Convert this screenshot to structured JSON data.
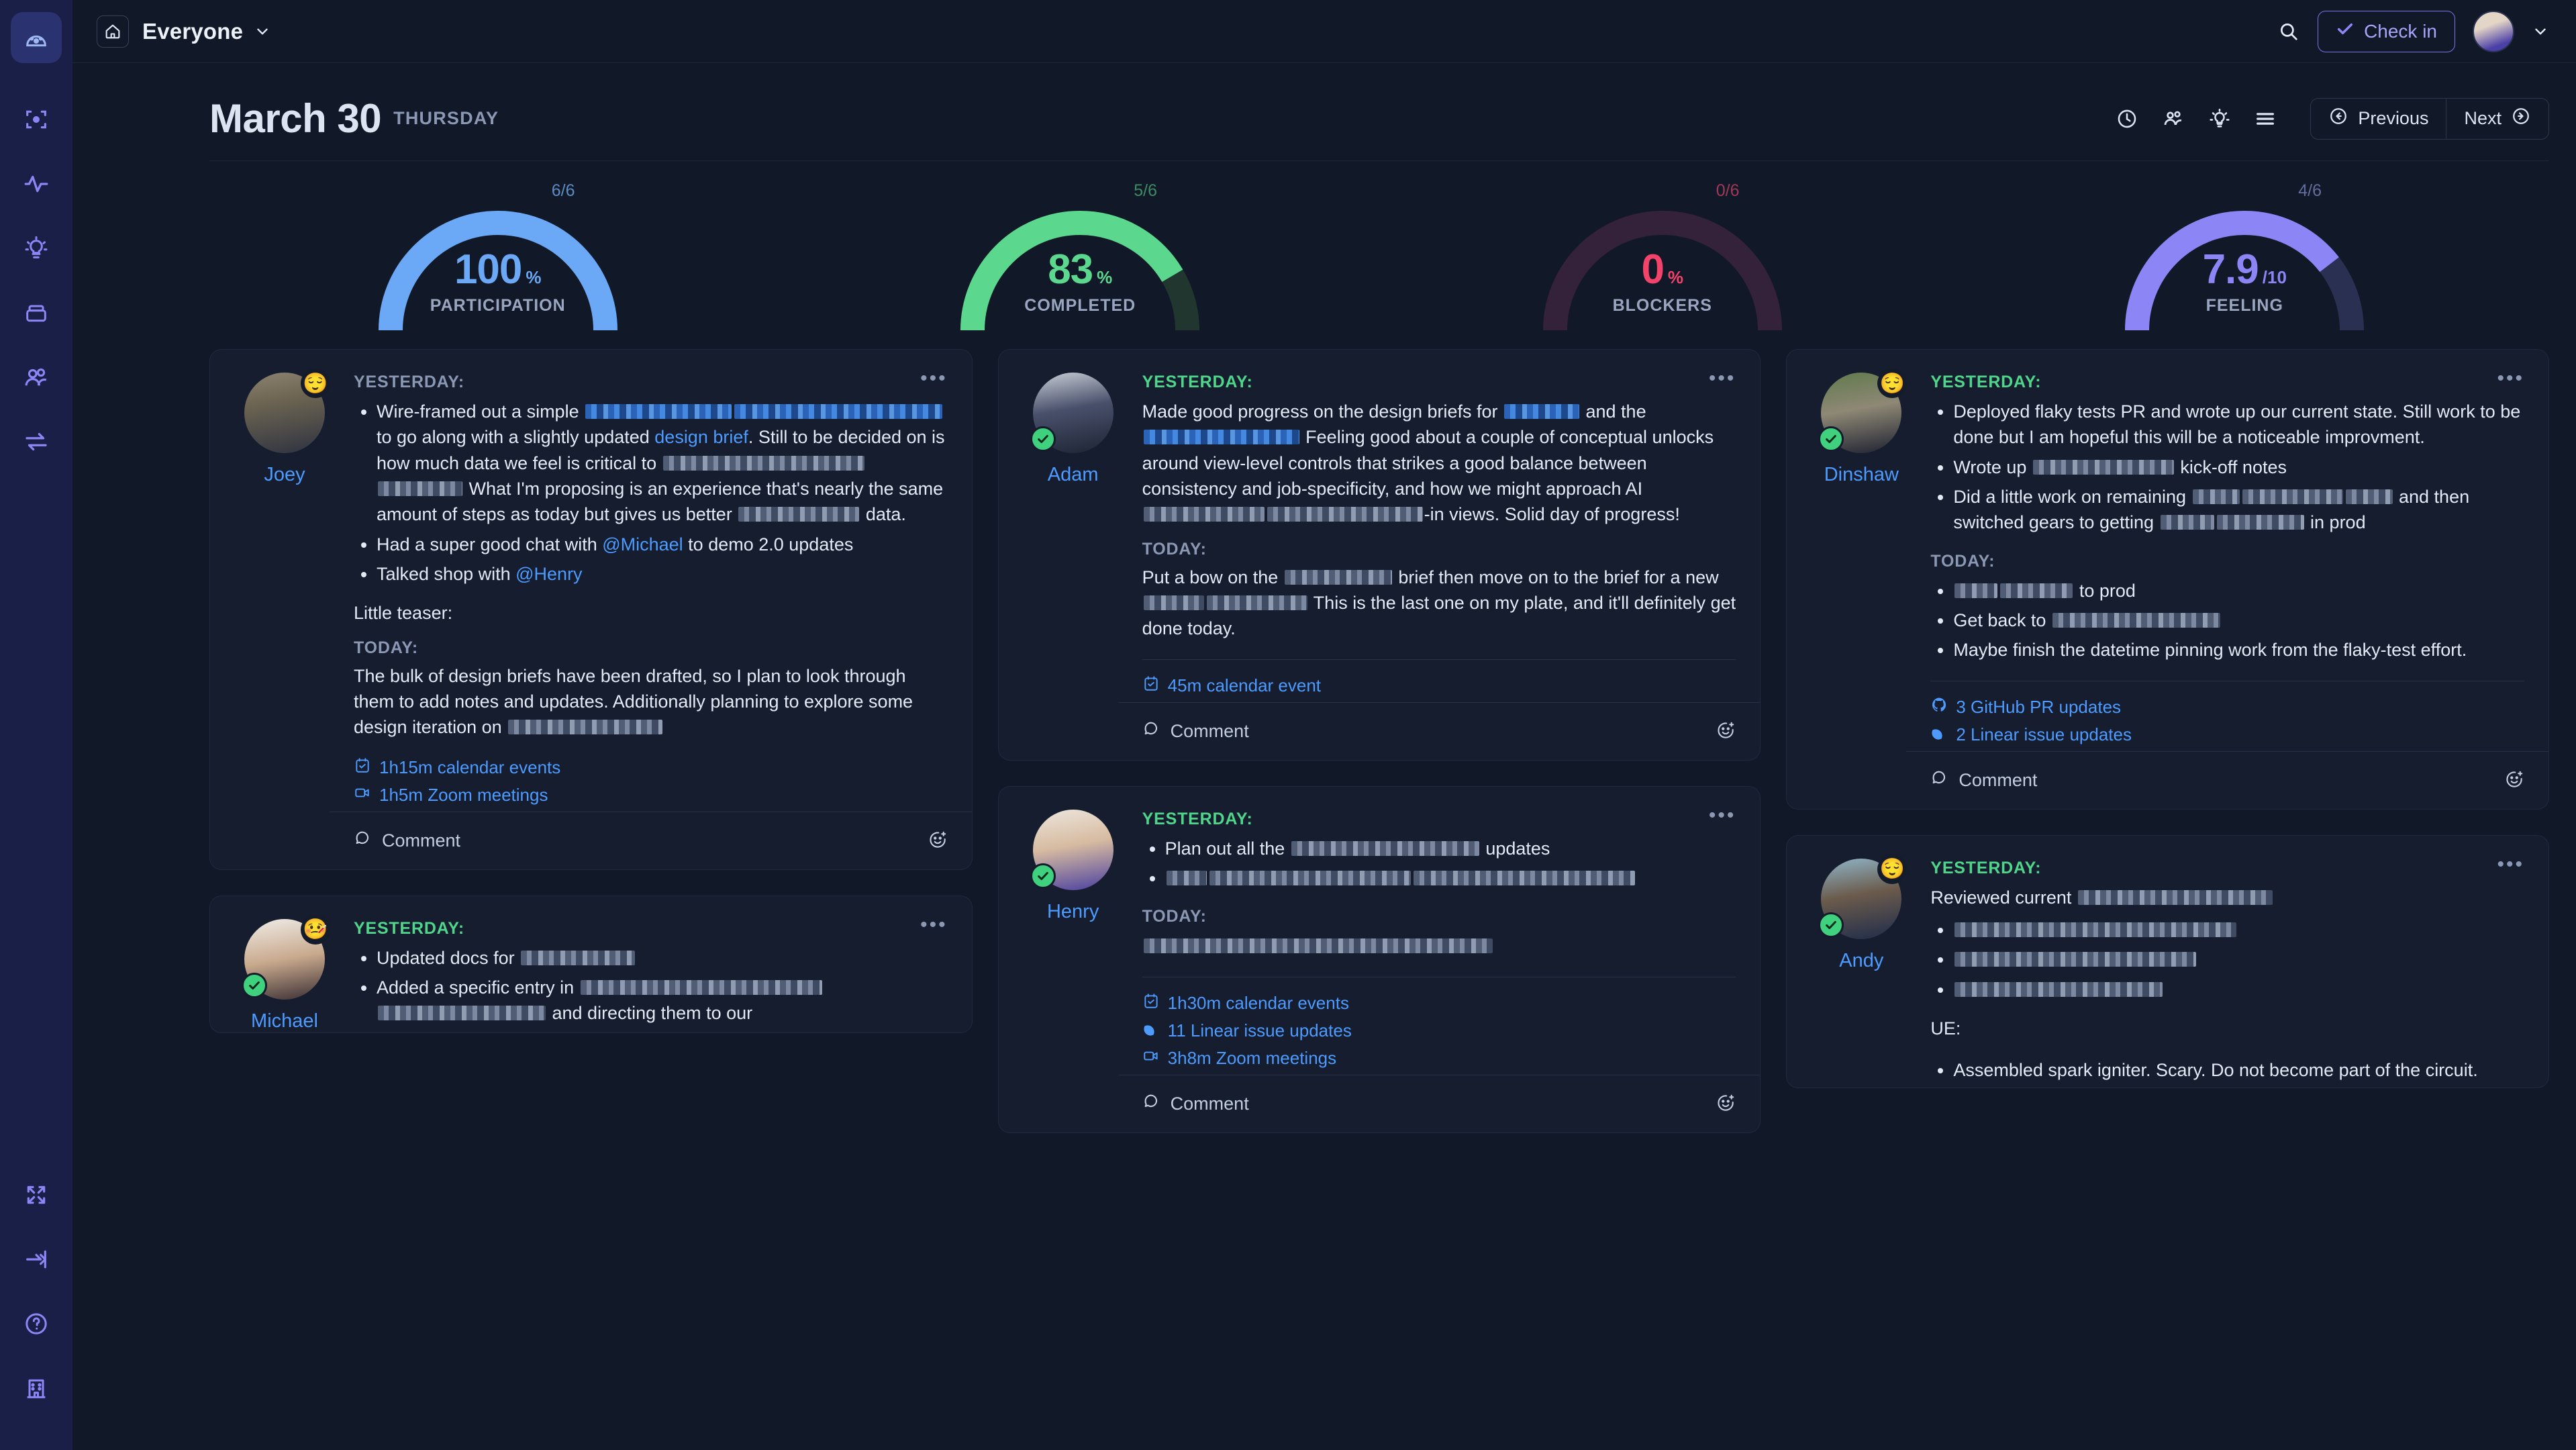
{
  "sidebar": {
    "logo": "dashboard-gauge-logo",
    "items": [
      {
        "icon": "focus-target-icon",
        "name": "focus"
      },
      {
        "icon": "activity-pulse-icon",
        "name": "activity"
      },
      {
        "icon": "lightbulb-icon",
        "name": "ideas"
      },
      {
        "icon": "archive-box-icon",
        "name": "archive"
      },
      {
        "icon": "people-icon",
        "name": "people"
      },
      {
        "icon": "swap-arrows-icon",
        "name": "integrations"
      }
    ],
    "bottom_items": [
      {
        "icon": "expand-icon",
        "name": "expand"
      },
      {
        "icon": "collapse-sidebar-icon",
        "name": "collapse"
      },
      {
        "icon": "help-circle-icon",
        "name": "help"
      },
      {
        "icon": "building-icon",
        "name": "organization"
      }
    ]
  },
  "topbar": {
    "home_icon": "home-icon",
    "space_name": "Everyone",
    "chevron": "chevron-down-icon",
    "search_icon": "search-icon",
    "checkin_label": "Check in",
    "checkin_icon": "check-icon",
    "avatar": "user-avatar",
    "avatar_chevron": "chevron-down-icon"
  },
  "header": {
    "date": "March 30",
    "weekday": "THURSDAY",
    "tools": [
      {
        "icon": "clock-icon",
        "name": "history"
      },
      {
        "icon": "people-icon",
        "name": "participants"
      },
      {
        "icon": "lightbulb-icon",
        "name": "insights"
      },
      {
        "icon": "list-icon",
        "name": "list-view"
      }
    ],
    "previous_label": "Previous",
    "next_label": "Next"
  },
  "gauges": [
    {
      "fraction": "6/6",
      "value": "100",
      "unit": "%",
      "label": "PARTICIPATION",
      "percent": 100,
      "color": "#6BA8F5",
      "track": "#1E2C45"
    },
    {
      "fraction": "5/6",
      "value": "83",
      "unit": "%",
      "label": "COMPLETED",
      "percent": 83,
      "color": "#5CD88E",
      "track": "#20362F"
    },
    {
      "fraction": "0/6",
      "value": "0",
      "unit": "%",
      "label": "BLOCKERS",
      "percent": 0,
      "color": "#F4436B",
      "track": "#33223A"
    },
    {
      "fraction": "4/6",
      "value": "7.9",
      "unit": "/10",
      "label": "FEELING",
      "percent": 79,
      "color": "#8B85F5",
      "track": "#2A3052"
    }
  ],
  "cards": {
    "joey": {
      "author": "Joey",
      "avatar_class": "joey",
      "emoji": "😌",
      "has_check": false,
      "yesterday_label": "YESTERDAY:",
      "today_label": "TODAY:",
      "label_color": "gray",
      "y_b1_a": "Wire-framed out a simple ",
      "y_b1_b": " to go along with a slightly updated ",
      "y_b1_link": "design brief",
      "y_b1_c": ". Still to be decided on is how much data we feel is critical to ",
      "y_b1_d": " What I'm proposing is an experience that's nearly the same amount of steps as today but gives us better ",
      "y_b1_e": " data.",
      "y_b2_a": "Had a super good chat with ",
      "y_b2_mention": "@Michael",
      "y_b2_b": " to demo 2.0 updates",
      "y_b3_a": "Talked shop with ",
      "y_b3_mention": "@Henry",
      "teaser": "Little teaser:",
      "today_text_a": "The bulk of design briefs have been drafted, so I plan to look through them to add notes and updates. Additionally planning to explore some design iteration on ",
      "meta": [
        {
          "icon": "calendar-icon",
          "label": "1h15m calendar events"
        },
        {
          "icon": "video-camera-icon",
          "label": "1h5m Zoom meetings"
        }
      ],
      "comment_label": "Comment"
    },
    "michael": {
      "author": "Michael",
      "avatar_class": "michael",
      "emoji": "🤒",
      "has_check": true,
      "yesterday_label": "YESTERDAY:",
      "label_color": "green",
      "y_b1_a": "Updated docs for ",
      "y_b2_a": "Added a specific entry in ",
      "y_b2_b": " and directing them to our"
    },
    "adam": {
      "author": "Adam",
      "avatar_class": "adam",
      "emoji": null,
      "has_check": true,
      "yesterday_label": "YESTERDAY:",
      "today_label": "TODAY:",
      "label_color": "green",
      "y_text_a": "Made good progress on the design briefs for ",
      "y_text_b": " and the ",
      "y_text_c": " Feeling good about a couple of conceptual unlocks around view-level controls that strikes a good balance between consistency and job-specificity, and how we might approach AI ",
      "y_text_d": "-in views. Solid day of progress!",
      "t_text_a": "Put a bow on the ",
      "t_text_b": " brief then move on to the brief for a new ",
      "t_text_c": " This is the last one on my plate, and it'll definitely get done today.",
      "meta": [
        {
          "icon": "calendar-icon",
          "label": "45m calendar event"
        }
      ],
      "comment_label": "Comment"
    },
    "henry": {
      "author": "Henry",
      "avatar_class": "henry",
      "emoji": null,
      "has_check": true,
      "yesterday_label": "YESTERDAY:",
      "today_label": "TODAY:",
      "label_color": "green",
      "y_b1_a": "Plan out all the ",
      "y_b1_b": " updates",
      "meta": [
        {
          "icon": "calendar-icon",
          "label": "1h30m calendar events"
        },
        {
          "icon": "linear-icon",
          "label": "11 Linear issue updates"
        },
        {
          "icon": "video-camera-icon",
          "label": "3h8m Zoom meetings"
        }
      ],
      "comment_label": "Comment"
    },
    "dinshaw": {
      "author": "Dinshaw",
      "avatar_class": "dinshaw",
      "emoji": "😌",
      "has_check": true,
      "yesterday_label": "YESTERDAY:",
      "today_label": "TODAY:",
      "label_color": "green",
      "y_b1": "Deployed flaky tests PR and wrote up our current state. Still work to be done but I am hopeful this will be a noticeable improvment.",
      "y_b2_a": "Wrote up ",
      "y_b2_b": " kick-off notes",
      "y_b3_a": "Did a little work on remaining ",
      "y_b3_b": " and then switched gears to getting ",
      "y_b3_c": " in prod",
      "t_b1_b": " to prod",
      "t_b2_a": "Get back to ",
      "t_b3": "Maybe finish the datetime pinning work from the flaky-test effort.",
      "meta": [
        {
          "icon": "github-icon",
          "label": "3 GitHub PR updates"
        },
        {
          "icon": "linear-icon",
          "label": "2 Linear issue updates"
        }
      ],
      "comment_label": "Comment"
    },
    "andy": {
      "author": "Andy",
      "avatar_class": "andy",
      "emoji": "😌",
      "has_check": true,
      "yesterday_label": "YESTERDAY:",
      "label_color": "green",
      "y_text_a": "Reviewed current ",
      "ue_label": "UE:",
      "ue_b1": "Assembled spark igniter. Scary. Do not become part of the circuit."
    }
  }
}
